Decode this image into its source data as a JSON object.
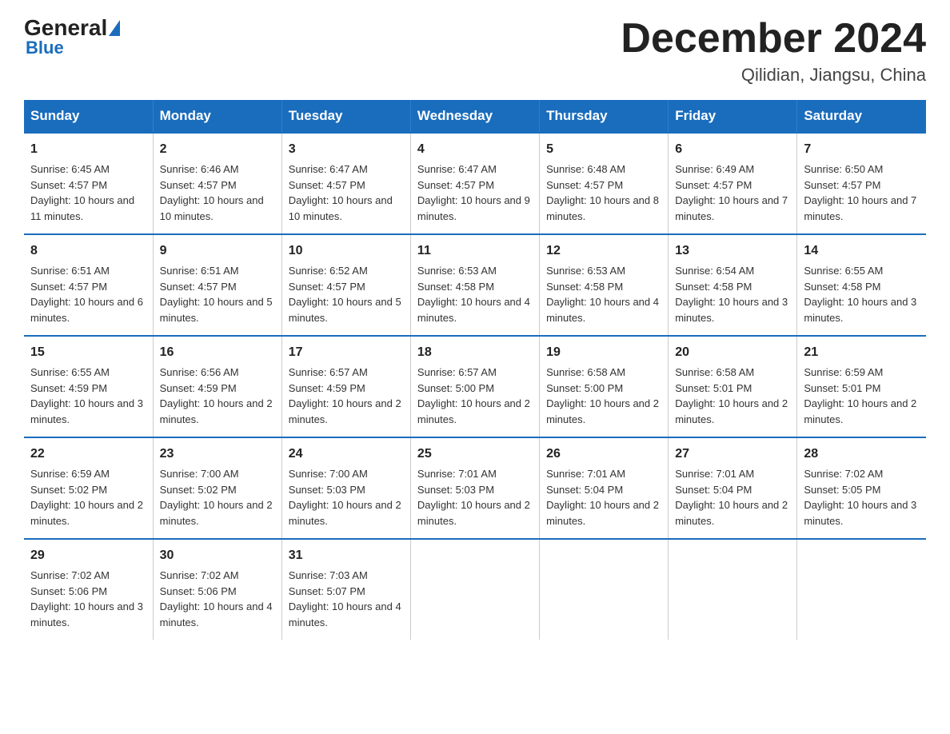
{
  "logo": {
    "general": "General",
    "blue": "Blue"
  },
  "header": {
    "title": "December 2024",
    "subtitle": "Qilidian, Jiangsu, China"
  },
  "days_of_week": [
    "Sunday",
    "Monday",
    "Tuesday",
    "Wednesday",
    "Thursday",
    "Friday",
    "Saturday"
  ],
  "weeks": [
    [
      {
        "num": "1",
        "sunrise": "Sunrise: 6:45 AM",
        "sunset": "Sunset: 4:57 PM",
        "daylight": "Daylight: 10 hours and 11 minutes."
      },
      {
        "num": "2",
        "sunrise": "Sunrise: 6:46 AM",
        "sunset": "Sunset: 4:57 PM",
        "daylight": "Daylight: 10 hours and 10 minutes."
      },
      {
        "num": "3",
        "sunrise": "Sunrise: 6:47 AM",
        "sunset": "Sunset: 4:57 PM",
        "daylight": "Daylight: 10 hours and 10 minutes."
      },
      {
        "num": "4",
        "sunrise": "Sunrise: 6:47 AM",
        "sunset": "Sunset: 4:57 PM",
        "daylight": "Daylight: 10 hours and 9 minutes."
      },
      {
        "num": "5",
        "sunrise": "Sunrise: 6:48 AM",
        "sunset": "Sunset: 4:57 PM",
        "daylight": "Daylight: 10 hours and 8 minutes."
      },
      {
        "num": "6",
        "sunrise": "Sunrise: 6:49 AM",
        "sunset": "Sunset: 4:57 PM",
        "daylight": "Daylight: 10 hours and 7 minutes."
      },
      {
        "num": "7",
        "sunrise": "Sunrise: 6:50 AM",
        "sunset": "Sunset: 4:57 PM",
        "daylight": "Daylight: 10 hours and 7 minutes."
      }
    ],
    [
      {
        "num": "8",
        "sunrise": "Sunrise: 6:51 AM",
        "sunset": "Sunset: 4:57 PM",
        "daylight": "Daylight: 10 hours and 6 minutes."
      },
      {
        "num": "9",
        "sunrise": "Sunrise: 6:51 AM",
        "sunset": "Sunset: 4:57 PM",
        "daylight": "Daylight: 10 hours and 5 minutes."
      },
      {
        "num": "10",
        "sunrise": "Sunrise: 6:52 AM",
        "sunset": "Sunset: 4:57 PM",
        "daylight": "Daylight: 10 hours and 5 minutes."
      },
      {
        "num": "11",
        "sunrise": "Sunrise: 6:53 AM",
        "sunset": "Sunset: 4:58 PM",
        "daylight": "Daylight: 10 hours and 4 minutes."
      },
      {
        "num": "12",
        "sunrise": "Sunrise: 6:53 AM",
        "sunset": "Sunset: 4:58 PM",
        "daylight": "Daylight: 10 hours and 4 minutes."
      },
      {
        "num": "13",
        "sunrise": "Sunrise: 6:54 AM",
        "sunset": "Sunset: 4:58 PM",
        "daylight": "Daylight: 10 hours and 3 minutes."
      },
      {
        "num": "14",
        "sunrise": "Sunrise: 6:55 AM",
        "sunset": "Sunset: 4:58 PM",
        "daylight": "Daylight: 10 hours and 3 minutes."
      }
    ],
    [
      {
        "num": "15",
        "sunrise": "Sunrise: 6:55 AM",
        "sunset": "Sunset: 4:59 PM",
        "daylight": "Daylight: 10 hours and 3 minutes."
      },
      {
        "num": "16",
        "sunrise": "Sunrise: 6:56 AM",
        "sunset": "Sunset: 4:59 PM",
        "daylight": "Daylight: 10 hours and 2 minutes."
      },
      {
        "num": "17",
        "sunrise": "Sunrise: 6:57 AM",
        "sunset": "Sunset: 4:59 PM",
        "daylight": "Daylight: 10 hours and 2 minutes."
      },
      {
        "num": "18",
        "sunrise": "Sunrise: 6:57 AM",
        "sunset": "Sunset: 5:00 PM",
        "daylight": "Daylight: 10 hours and 2 minutes."
      },
      {
        "num": "19",
        "sunrise": "Sunrise: 6:58 AM",
        "sunset": "Sunset: 5:00 PM",
        "daylight": "Daylight: 10 hours and 2 minutes."
      },
      {
        "num": "20",
        "sunrise": "Sunrise: 6:58 AM",
        "sunset": "Sunset: 5:01 PM",
        "daylight": "Daylight: 10 hours and 2 minutes."
      },
      {
        "num": "21",
        "sunrise": "Sunrise: 6:59 AM",
        "sunset": "Sunset: 5:01 PM",
        "daylight": "Daylight: 10 hours and 2 minutes."
      }
    ],
    [
      {
        "num": "22",
        "sunrise": "Sunrise: 6:59 AM",
        "sunset": "Sunset: 5:02 PM",
        "daylight": "Daylight: 10 hours and 2 minutes."
      },
      {
        "num": "23",
        "sunrise": "Sunrise: 7:00 AM",
        "sunset": "Sunset: 5:02 PM",
        "daylight": "Daylight: 10 hours and 2 minutes."
      },
      {
        "num": "24",
        "sunrise": "Sunrise: 7:00 AM",
        "sunset": "Sunset: 5:03 PM",
        "daylight": "Daylight: 10 hours and 2 minutes."
      },
      {
        "num": "25",
        "sunrise": "Sunrise: 7:01 AM",
        "sunset": "Sunset: 5:03 PM",
        "daylight": "Daylight: 10 hours and 2 minutes."
      },
      {
        "num": "26",
        "sunrise": "Sunrise: 7:01 AM",
        "sunset": "Sunset: 5:04 PM",
        "daylight": "Daylight: 10 hours and 2 minutes."
      },
      {
        "num": "27",
        "sunrise": "Sunrise: 7:01 AM",
        "sunset": "Sunset: 5:04 PM",
        "daylight": "Daylight: 10 hours and 2 minutes."
      },
      {
        "num": "28",
        "sunrise": "Sunrise: 7:02 AM",
        "sunset": "Sunset: 5:05 PM",
        "daylight": "Daylight: 10 hours and 3 minutes."
      }
    ],
    [
      {
        "num": "29",
        "sunrise": "Sunrise: 7:02 AM",
        "sunset": "Sunset: 5:06 PM",
        "daylight": "Daylight: 10 hours and 3 minutes."
      },
      {
        "num": "30",
        "sunrise": "Sunrise: 7:02 AM",
        "sunset": "Sunset: 5:06 PM",
        "daylight": "Daylight: 10 hours and 4 minutes."
      },
      {
        "num": "31",
        "sunrise": "Sunrise: 7:03 AM",
        "sunset": "Sunset: 5:07 PM",
        "daylight": "Daylight: 10 hours and 4 minutes."
      },
      {
        "num": "",
        "sunrise": "",
        "sunset": "",
        "daylight": ""
      },
      {
        "num": "",
        "sunrise": "",
        "sunset": "",
        "daylight": ""
      },
      {
        "num": "",
        "sunrise": "",
        "sunset": "",
        "daylight": ""
      },
      {
        "num": "",
        "sunrise": "",
        "sunset": "",
        "daylight": ""
      }
    ]
  ]
}
